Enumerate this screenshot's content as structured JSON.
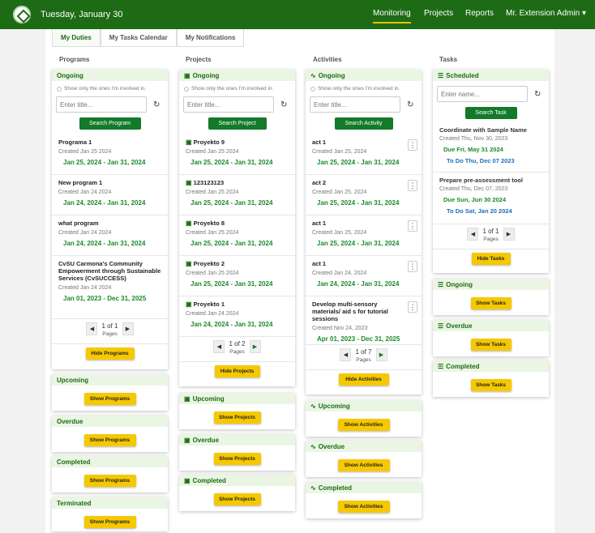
{
  "header": {
    "date": "Tuesday, January 30",
    "nav": [
      "Monitoring",
      "Projects",
      "Reports",
      "Mr. Extension Admin"
    ]
  },
  "tabs": [
    "My Duties",
    "My Tasks Calendar",
    "My Notifications"
  ],
  "columns": {
    "programs": "Programs",
    "projects": "Projects",
    "activities": "Activities",
    "tasks": "Tasks"
  },
  "common": {
    "involved": "Show only the ones I'm involved in.",
    "enter_title": "Enter title...",
    "enter_name": "Enter name...",
    "pages": "Pages"
  },
  "programs": {
    "ongoing": "Ongoing",
    "search_btn": "Search Program",
    "hide_btn": "Hide Programs",
    "page": "1 of 1",
    "items": [
      {
        "title": "Programa 1",
        "created": "Created Jan 25 2024",
        "dates": "Jan 25, 2024 - Jan 31, 2024"
      },
      {
        "title": "New program 1",
        "created": "Created Jan 24 2024",
        "dates": "Jan 24, 2024 - Jan 31, 2024"
      },
      {
        "title": "what program",
        "created": "Created Jan 24 2024",
        "dates": "Jan 24, 2024 - Jan 31, 2024"
      },
      {
        "title": "CvSU Carmona's Community Empowerment through Sustainable Services (CvSUCCESS)",
        "created": "Created Jan 24 2024",
        "dates": "Jan 01, 2023 - Dec 31, 2025"
      }
    ],
    "other": [
      {
        "label": "Upcoming",
        "btn": "Show Programs"
      },
      {
        "label": "Overdue",
        "btn": "Show Programs"
      },
      {
        "label": "Completed",
        "btn": "Show Programs"
      },
      {
        "label": "Terminated",
        "btn": "Show Programs"
      }
    ]
  },
  "projects": {
    "ongoing": "Ongoing",
    "search_btn": "Search Project",
    "hide_btn": "Hide Projects",
    "page": "1 of 2",
    "items": [
      {
        "title": "Proyekto 9",
        "created": "Created Jan 25 2024",
        "dates": "Jan 25, 2024 - Jan 31, 2024"
      },
      {
        "title": "123123123",
        "created": "Created Jan 25 2024",
        "dates": "Jan 25, 2024 - Jan 31, 2024"
      },
      {
        "title": "Proyekto 8",
        "created": "Created Jan 25 2024",
        "dates": "Jan 25, 2024 - Jan 31, 2024"
      },
      {
        "title": "Proyekto 2",
        "created": "Created Jan 25 2024",
        "dates": "Jan 25, 2024 - Jan 31, 2024"
      },
      {
        "title": "Proyekto 1",
        "created": "Created Jan 24 2024",
        "dates": "Jan 24, 2024 - Jan 31, 2024"
      }
    ],
    "other": [
      {
        "label": "Upcoming",
        "btn": "Show Projects"
      },
      {
        "label": "Overdue",
        "btn": "Show Projects"
      },
      {
        "label": "Completed",
        "btn": "Show Projects"
      }
    ]
  },
  "activities": {
    "ongoing": "Ongoing",
    "search_btn": "Search Activity",
    "hide_btn": "Hide Activities",
    "page": "1 of 7",
    "items": [
      {
        "title": "act 1",
        "created": "Created Jan 25, 2024",
        "dates": "Jan 25, 2024 - Jan 31, 2024"
      },
      {
        "title": "act 2",
        "created": "Created Jan 25, 2024",
        "dates": "Jan 25, 2024 - Jan 31, 2024"
      },
      {
        "title": "act 1",
        "created": "Created Jan 25, 2024",
        "dates": "Jan 25, 2024 - Jan 31, 2024"
      },
      {
        "title": "act 1",
        "created": "Created Jan 24, 2024",
        "dates": "Jan 24, 2024 - Jan 31, 2024"
      },
      {
        "title": "Develop multi-sensory materials/ aid s for tutorial sessions",
        "created": "Created Nov 24, 2023",
        "dates": "Apr 01, 2023 - Dec 31, 2025"
      }
    ],
    "other": [
      {
        "label": "Upcoming",
        "btn": "Show Activities"
      },
      {
        "label": "Overdue",
        "btn": "Show Activities"
      },
      {
        "label": "Completed",
        "btn": "Show Activities"
      }
    ]
  },
  "tasks": {
    "scheduled": "Scheduled",
    "search_btn": "Search Task",
    "hide_btn": "Hide Tasks",
    "page": "1 of 1",
    "items": [
      {
        "title": "Coordinate with Sample Name",
        "created": "Created Thu, Nov 30, 2023",
        "due": "Due Fri, May 31 2024",
        "todo": "To Do Thu, Dec 07 2023"
      },
      {
        "title": "Prepare pre-assessment tool",
        "created": "Created Thu, Dec 07, 2023",
        "due": "Due Sun, Jun 30 2024",
        "todo": "To Do Sat, Jan 20 2024"
      }
    ],
    "other": [
      {
        "label": "Ongoing",
        "btn": "Show Tasks"
      },
      {
        "label": "Overdue",
        "btn": "Show Tasks"
      },
      {
        "label": "Completed",
        "btn": "Show Tasks"
      }
    ]
  }
}
